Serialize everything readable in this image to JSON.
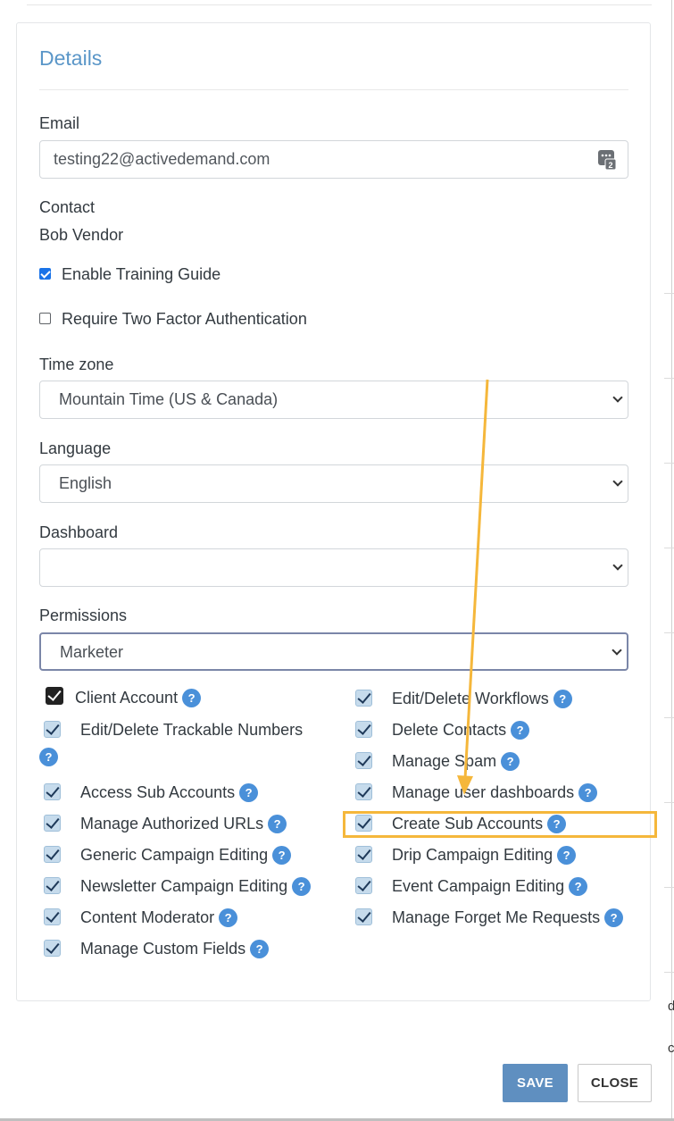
{
  "card": {
    "title": "Details"
  },
  "email": {
    "label": "Email",
    "value": "testing22@activedemand.com"
  },
  "contact": {
    "label": "Contact",
    "value": "Bob Vendor"
  },
  "options": {
    "training_guide": {
      "label": "Enable Training Guide",
      "checked": true
    },
    "two_factor": {
      "label": "Require Two Factor Authentication",
      "checked": false
    }
  },
  "timezone": {
    "label": "Time zone",
    "selected": "Mountain Time (US & Canada)"
  },
  "language": {
    "label": "Language",
    "selected": "English"
  },
  "dashboard": {
    "label": "Dashboard",
    "selected": ""
  },
  "permissions": {
    "label": "Permissions",
    "selected": "Marketer",
    "left": [
      {
        "label": "Client Account",
        "checked": true
      },
      {
        "label": "Edit/Delete Trackable Numbers",
        "checked": true
      },
      {
        "label": "Access Sub Accounts",
        "checked": true
      },
      {
        "label": "Manage Authorized URLs",
        "checked": true
      },
      {
        "label": "Generic Campaign Editing",
        "checked": true
      },
      {
        "label": "Newsletter Campaign Editing",
        "checked": true
      },
      {
        "label": "Content Moderator",
        "checked": true
      },
      {
        "label": "Manage Custom Fields",
        "checked": true
      }
    ],
    "right": [
      {
        "label": "Edit/Delete Workflows",
        "checked": true
      },
      {
        "label": "Delete Contacts",
        "checked": true
      },
      {
        "label": "Manage Spam",
        "checked": true
      },
      {
        "label": "Manage user dashboards",
        "checked": true
      },
      {
        "label": "Create Sub Accounts",
        "checked": true,
        "highlighted": true
      },
      {
        "label": "Drip Campaign Editing",
        "checked": true
      },
      {
        "label": "Event Campaign Editing",
        "checked": true
      },
      {
        "label": "Manage Forget Me Requests",
        "checked": true
      }
    ]
  },
  "help_glyph": "?",
  "buttons": {
    "save": "SAVE",
    "close": "CLOSE"
  },
  "edge_glyphs": [
    "d",
    "c"
  ],
  "colors": {
    "accent": "#5a96c8",
    "save_button": "#5f8fc0",
    "annotation": "#f5b73b",
    "help_icon": "#4a90d9"
  }
}
